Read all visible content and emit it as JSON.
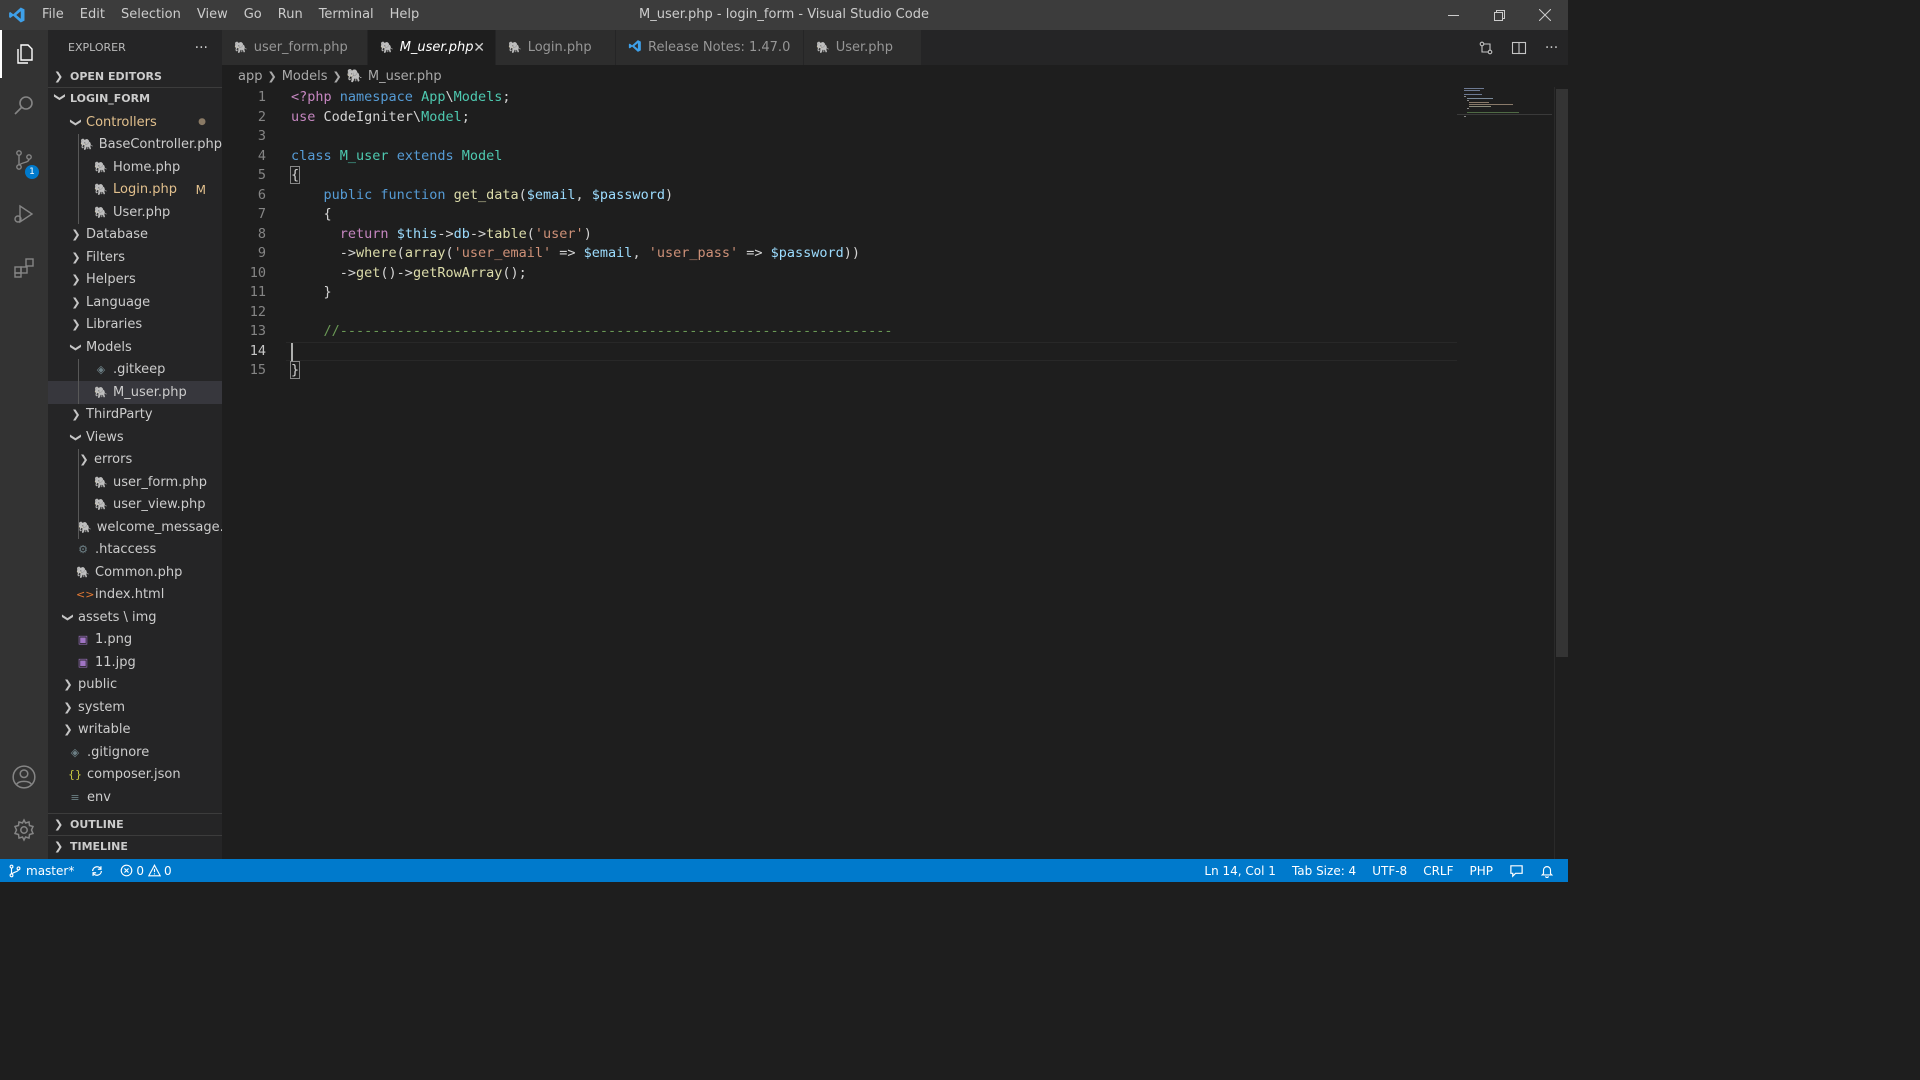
{
  "window": {
    "title": "M_user.php - login_form - Visual Studio Code"
  },
  "menu": [
    "File",
    "Edit",
    "Selection",
    "View",
    "Go",
    "Run",
    "Terminal",
    "Help"
  ],
  "activity_bar": {
    "items": [
      "explorer-icon",
      "search-icon",
      "source-control-icon",
      "run-debug-icon",
      "extensions-icon"
    ],
    "source_control_badge": "1",
    "bottom": [
      "account-icon",
      "settings-gear-icon"
    ]
  },
  "sidebar": {
    "title": "EXPLORER",
    "more_label": "···",
    "open_editors": "OPEN EDITORS",
    "project": "LOGIN_FORM",
    "tree": [
      {
        "label": "Controllers",
        "type": "folder-open",
        "indent": 1,
        "status": "dot",
        "modified": true
      },
      {
        "label": "BaseController.php",
        "type": "php",
        "indent": 2
      },
      {
        "label": "Home.php",
        "type": "php",
        "indent": 2
      },
      {
        "label": "Login.php",
        "type": "php",
        "indent": 2,
        "status": "M",
        "modified": true
      },
      {
        "label": "User.php",
        "type": "php",
        "indent": 2
      },
      {
        "label": "Database",
        "type": "folder",
        "indent": 1
      },
      {
        "label": "Filters",
        "type": "folder",
        "indent": 1
      },
      {
        "label": "Helpers",
        "type": "folder",
        "indent": 1
      },
      {
        "label": "Language",
        "type": "folder",
        "indent": 1
      },
      {
        "label": "Libraries",
        "type": "folder",
        "indent": 1
      },
      {
        "label": "Models",
        "type": "folder-open",
        "indent": 1
      },
      {
        "label": ".gitkeep",
        "type": "cfg",
        "indent": 2
      },
      {
        "label": "M_user.php",
        "type": "php",
        "indent": 2,
        "selected": true
      },
      {
        "label": "ThirdParty",
        "type": "folder",
        "indent": 1
      },
      {
        "label": "Views",
        "type": "folder-open",
        "indent": 1
      },
      {
        "label": "errors",
        "type": "folder",
        "indent": 2
      },
      {
        "label": "user_form.php",
        "type": "php",
        "indent": 2
      },
      {
        "label": "user_view.php",
        "type": "php",
        "indent": 2
      },
      {
        "label": "welcome_message....",
        "type": "php",
        "indent": 2
      },
      {
        "label": ".htaccess",
        "type": "gear",
        "indent": 1
      },
      {
        "label": "Common.php",
        "type": "php",
        "indent": 1
      },
      {
        "label": "index.html",
        "type": "html",
        "indent": 1
      },
      {
        "label": "assets \\ img",
        "type": "folder-open",
        "indent": 0
      },
      {
        "label": "1.png",
        "type": "img",
        "indent": 1
      },
      {
        "label": "11.jpg",
        "type": "img",
        "indent": 1
      },
      {
        "label": "public",
        "type": "folder",
        "indent": 0
      },
      {
        "label": "system",
        "type": "folder",
        "indent": 0
      },
      {
        "label": "writable",
        "type": "folder",
        "indent": 0
      },
      {
        "label": ".gitignore",
        "type": "cfg",
        "indent": 0
      },
      {
        "label": "composer.json",
        "type": "json",
        "indent": 0
      },
      {
        "label": "env",
        "type": "text",
        "indent": 0
      }
    ],
    "outline": "OUTLINE",
    "timeline": "TIMELINE"
  },
  "tabs": [
    {
      "label": "user_form.php",
      "icon": "php-icon",
      "active": false
    },
    {
      "label": "M_user.php",
      "icon": "php-icon",
      "active": true,
      "close": "✕"
    },
    {
      "label": "Login.php",
      "icon": "php-icon",
      "active": false
    },
    {
      "label": "Release Notes: 1.47.0",
      "icon": "vscode-icon",
      "active": false
    },
    {
      "label": "User.php",
      "icon": "php-icon",
      "active": false
    }
  ],
  "tab_actions": [
    "open-changes-icon",
    "split-editor-icon",
    "more-actions-icon"
  ],
  "breadcrumb": [
    "app",
    "Models",
    "M_user.php"
  ],
  "editor": {
    "cursor_line": 14,
    "lines": [
      {
        "n": "1",
        "tokens": [
          [
            "c",
            "<?php "
          ],
          [
            "k",
            "namespace "
          ],
          [
            "t",
            "App"
          ],
          [
            "",
            "\\"
          ],
          [
            "t",
            "Models"
          ],
          [
            "",
            ";"
          ]
        ]
      },
      {
        "n": "2",
        "tokens": [
          [
            "c",
            "use "
          ],
          [
            "",
            "CodeIgniter\\"
          ],
          [
            "t",
            "Model"
          ],
          [
            "",
            ";"
          ]
        ]
      },
      {
        "n": "3",
        "tokens": []
      },
      {
        "n": "4",
        "tokens": [
          [
            "k",
            "class "
          ],
          [
            "t",
            "M_user "
          ],
          [
            "k",
            "extends "
          ],
          [
            "t",
            "Model"
          ]
        ]
      },
      {
        "n": "5",
        "tokens": [
          [
            "b",
            "{"
          ]
        ]
      },
      {
        "n": "6",
        "tokens": [
          [
            "",
            "    "
          ],
          [
            "k",
            "public "
          ],
          [
            "k",
            "function "
          ],
          [
            "f",
            "get_data"
          ],
          [
            "",
            "("
          ],
          [
            "v",
            "$email"
          ],
          [
            "",
            ", "
          ],
          [
            "v",
            "$password"
          ],
          [
            "",
            ")"
          ]
        ]
      },
      {
        "n": "7",
        "tokens": [
          [
            "",
            "    {"
          ]
        ]
      },
      {
        "n": "8",
        "tokens": [
          [
            "",
            "      "
          ],
          [
            "c",
            "return "
          ],
          [
            "v",
            "$this"
          ],
          [
            "",
            "->"
          ],
          [
            "v",
            "db"
          ],
          [
            "",
            "->"
          ],
          [
            "f",
            "table"
          ],
          [
            "",
            "("
          ],
          [
            "s",
            "'user'"
          ],
          [
            "",
            ")"
          ]
        ]
      },
      {
        "n": "9",
        "tokens": [
          [
            "",
            "      ->"
          ],
          [
            "f",
            "where"
          ],
          [
            "",
            "("
          ],
          [
            "f",
            "array"
          ],
          [
            "",
            "("
          ],
          [
            "s",
            "'user_email'"
          ],
          [
            "",
            " => "
          ],
          [
            "v",
            "$email"
          ],
          [
            "",
            ", "
          ],
          [
            "s",
            "'user_pass'"
          ],
          [
            "",
            " => "
          ],
          [
            "v",
            "$password"
          ],
          [
            "",
            "))"
          ]
        ]
      },
      {
        "n": "10",
        "tokens": [
          [
            "",
            "      ->"
          ],
          [
            "f",
            "get"
          ],
          [
            "",
            "()->"
          ],
          [
            "f",
            "getRowArray"
          ],
          [
            "",
            "();"
          ]
        ]
      },
      {
        "n": "11",
        "tokens": [
          [
            "",
            "    }"
          ]
        ]
      },
      {
        "n": "12",
        "tokens": []
      },
      {
        "n": "13",
        "tokens": [
          [
            "",
            "    "
          ],
          [
            "cm",
            "//--------------------------------------------------------------------"
          ]
        ]
      },
      {
        "n": "14",
        "tokens": []
      },
      {
        "n": "15",
        "tokens": [
          [
            "b",
            "}"
          ]
        ]
      }
    ]
  },
  "status_bar": {
    "branch": "master*",
    "sync": "sync-icon",
    "errors": "0",
    "warnings": "0",
    "position": "Ln 14, Col 1",
    "tab_size": "Tab Size: 4",
    "encoding": "UTF-8",
    "eol": "CRLF",
    "language": "PHP"
  }
}
